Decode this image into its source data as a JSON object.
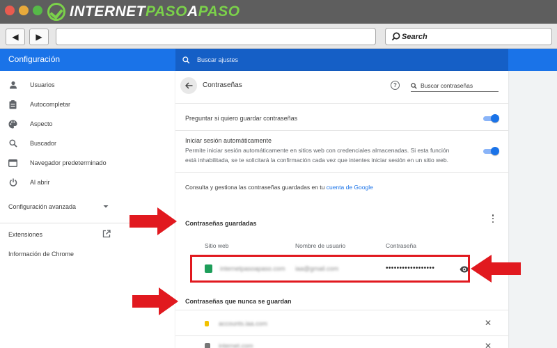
{
  "browser": {
    "logo_text_a": "INTERNET",
    "logo_text_b": "PASO",
    "logo_text_c": "A",
    "logo_text_d": "PASO",
    "back_glyph": "◀",
    "forward_glyph": "▶",
    "search_label": "Search",
    "search_icon": "search-icon"
  },
  "header": {
    "title": "Configuración",
    "search_placeholder": "Buscar ajustes"
  },
  "sidebar": {
    "items": [
      {
        "label": "Usuarios",
        "icon": "person-icon"
      },
      {
        "label": "Autocompletar",
        "icon": "clipboard-icon"
      },
      {
        "label": "Aspecto",
        "icon": "palette-icon"
      },
      {
        "label": "Buscador",
        "icon": "search-icon"
      },
      {
        "label": "Navegador predeterminado",
        "icon": "browser-icon"
      },
      {
        "label": "Al abrir",
        "icon": "power-icon"
      }
    ],
    "advanced": "Configuración avanzada",
    "extensions": "Extensiones",
    "about": "Información de Chrome"
  },
  "passwords": {
    "title": "Contraseñas",
    "search_placeholder": "Buscar contraseñas",
    "offer_save": "Preguntar si quiero guardar contraseñas",
    "auto_signin_title": "Iniciar sesión automáticamente",
    "auto_signin_desc_1": "Permite iniciar sesión automáticamente en sitios web con credenciales almacenadas. Si esta función",
    "auto_signin_desc_2": "está inhabilitada, se te solicitará la confirmación cada vez que intentes iniciar sesión en un sitio web.",
    "manage_prefix": "Consulta y gestiona las contraseñas guardadas en tu ",
    "manage_link": "cuenta de Google",
    "saved_title": "Contraseñas guardadas",
    "columns": [
      "Sitio web",
      "Nombre de usuario",
      "Contraseña"
    ],
    "saved_rows": [
      {
        "site": "internetpasoapaso.com",
        "user": "iaa@gmail.com",
        "password": "••••••••••••••••••"
      }
    ],
    "never_title": "Contraseñas que nunca se guardan",
    "never_rows": [
      {
        "site": "accounts.iaa.com"
      },
      {
        "site": "internet.com"
      }
    ],
    "toggles": {
      "offer_save": true,
      "auto_signin": true
    }
  },
  "colors": {
    "accent": "#1a73e8",
    "annotation": "#e1191f"
  }
}
